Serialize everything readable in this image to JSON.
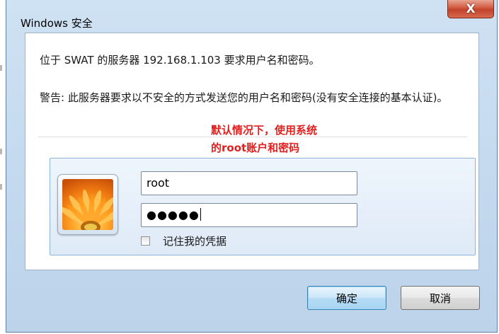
{
  "window": {
    "title": "Windows 安全",
    "close_label": "X"
  },
  "message": {
    "request": "位于 SWAT 的服务器 192.168.1.103 要求用户名和密码。",
    "warning": "警告: 此服务器要求以不安全的方式发送您的用户名和密码(没有安全连接的基本认证)。"
  },
  "annotation": {
    "line1": "默认情况下，使用系统",
    "line2": "的root账户和密码",
    "color": "#e0211f"
  },
  "credentials": {
    "avatar_icon": "flower-avatar-icon",
    "username_value": "root",
    "password_mask": "●●●●●",
    "remember_label": "记住我的凭据",
    "remember_checked": false
  },
  "buttons": {
    "ok_label": "确定",
    "cancel_label": "取消"
  }
}
